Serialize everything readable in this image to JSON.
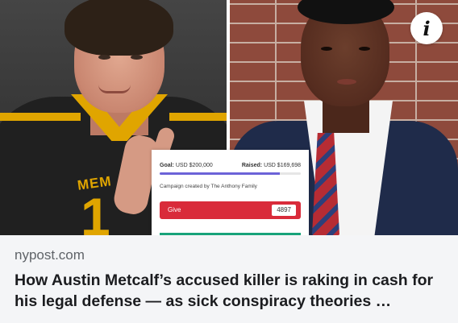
{
  "hero": {
    "left_photo": {
      "jersey_text": "MEM",
      "jersey_number": "1"
    },
    "info_icon": "info-icon"
  },
  "fundraiser": {
    "goal_label": "Goal:",
    "goal_value": "USD $200,000",
    "raised_label": "Raised:",
    "raised_value": "USD $169,698",
    "progress": 0.85,
    "creator": "Campaign created by The Anthony Family",
    "give_label": "Give",
    "give_count": "4897",
    "colors": {
      "give": "#d92b3a",
      "progress": "#6c63d8",
      "strip": "#18a37a"
    }
  },
  "article": {
    "source": "nypost.com",
    "headline": "How Austin Metcalf’s accused killer is raking in cash for his legal defense — as sick conspiracy theories …"
  }
}
